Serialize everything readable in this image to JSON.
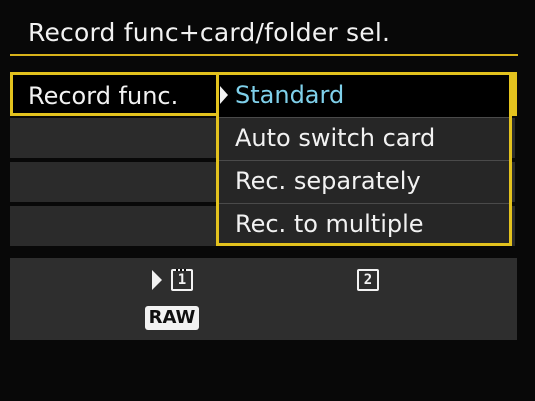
{
  "screen": {
    "title": "Record func+card/folder sel.",
    "accent_color": "#e3c21e",
    "selected_text_color": "#7fd0ea"
  },
  "menu": {
    "rows": [
      {
        "label": "Record func.",
        "selected": true
      },
      {
        "label": ""
      },
      {
        "label": ""
      },
      {
        "label": ""
      }
    ]
  },
  "dropdown": {
    "options": [
      {
        "label": "Standard",
        "selected": true
      },
      {
        "label": "Auto switch card",
        "selected": false
      },
      {
        "label": "Rec. separately",
        "selected": false
      },
      {
        "label": "Rec. to multiple",
        "selected": false
      }
    ]
  },
  "cards": {
    "card1": {
      "number": "1",
      "active": true,
      "icon": "card-1-icon"
    },
    "card2": {
      "number": "2",
      "active": false,
      "icon": "card-2-icon"
    },
    "quality_badge": "RAW"
  }
}
